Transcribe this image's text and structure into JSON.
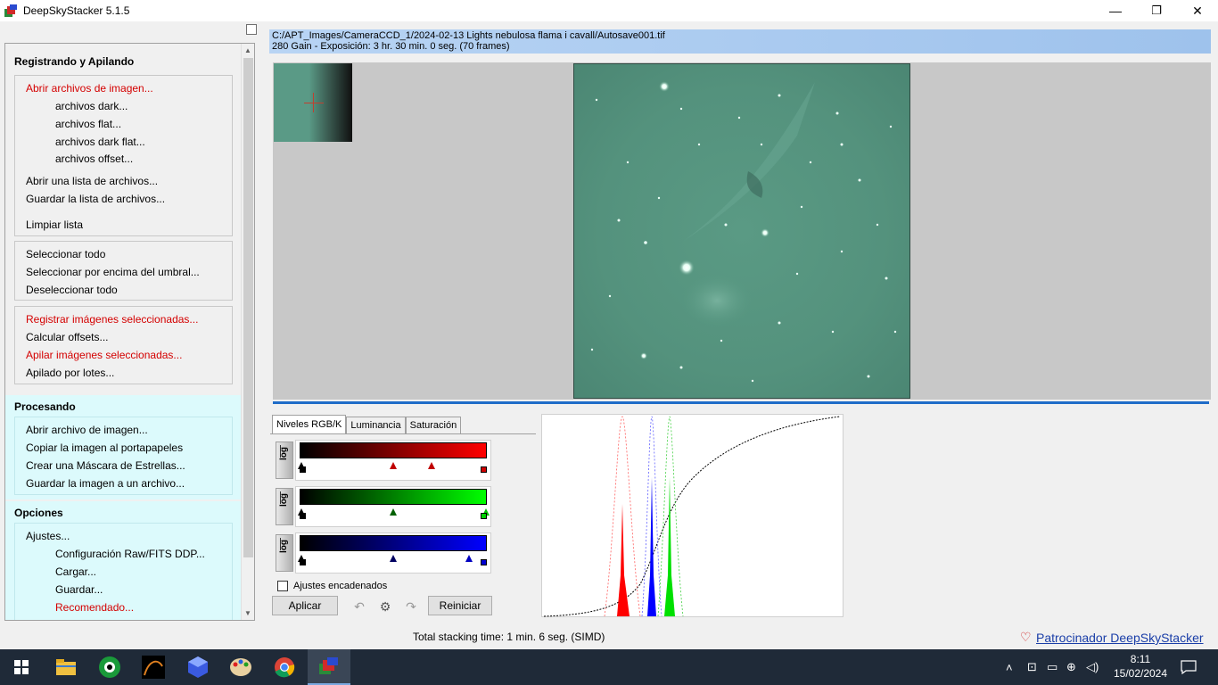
{
  "window": {
    "title": "DeepSkyStacker 5.1.5",
    "minimize": "—",
    "maximize": "❐",
    "close": "✕"
  },
  "left_panel": {
    "sections": [
      {
        "title": "Registrando y Apilando",
        "groups": [
          {
            "items": [
              {
                "label": "Abrir archivos de imagen...",
                "style": "red",
                "indent": false
              },
              {
                "label": "archivos dark...",
                "style": "normal",
                "indent": true
              },
              {
                "label": "archivos flat...",
                "style": "normal",
                "indent": true
              },
              {
                "label": "archivos dark flat...",
                "style": "normal",
                "indent": true
              },
              {
                "label": "archivos offset...",
                "style": "normal",
                "indent": true
              },
              {
                "label": "Abrir una lista de archivos...",
                "style": "normal",
                "indent": false
              },
              {
                "label": "Guardar la lista de archivos...",
                "style": "normal",
                "indent": false
              },
              {
                "label": "Limpiar lista",
                "style": "normal",
                "indent": false
              }
            ]
          },
          {
            "items": [
              {
                "label": "Seleccionar todo",
                "style": "normal"
              },
              {
                "label": "Seleccionar por encima del umbral...",
                "style": "normal"
              },
              {
                "label": "Deseleccionar todo",
                "style": "normal"
              }
            ]
          },
          {
            "items": [
              {
                "label": "Registrar imágenes seleccionadas...",
                "style": "red"
              },
              {
                "label": "Calcular offsets...",
                "style": "normal"
              },
              {
                "label": "Apilar imágenes seleccionadas...",
                "style": "red"
              },
              {
                "label": "Apilado por lotes...",
                "style": "normal"
              }
            ]
          }
        ]
      },
      {
        "title": "Procesando",
        "items": [
          {
            "label": "Abrir archivo de imagen..."
          },
          {
            "label": "Copiar la imagen al portapapeles"
          },
          {
            "label": "Crear una Máscara de Estrellas..."
          },
          {
            "label": "Guardar la imagen a un archivo..."
          }
        ]
      },
      {
        "title": "Opciones",
        "items": [
          {
            "label": "Ajustes...",
            "style": "normal",
            "indent": false
          },
          {
            "label": "Configuración Raw/FITS DDP...",
            "style": "normal",
            "indent": true
          },
          {
            "label": "Cargar...",
            "style": "normal",
            "indent": true
          },
          {
            "label": "Guardar...",
            "style": "normal",
            "indent": true
          },
          {
            "label": "Recomendado...",
            "style": "red",
            "indent": true
          }
        ]
      }
    ]
  },
  "file_info": {
    "path": "C:/APT_Images/CameraCCD_1/2024-02-13 Lights nebulosa flama i cavall/Autosave001.tif",
    "details": "280 Gain - Exposición: 3 hr. 30 min. 0 seg. (70 frames)"
  },
  "tabs": [
    {
      "label": "Niveles RGB/K",
      "active": true
    },
    {
      "label": "Luminancia",
      "active": false
    },
    {
      "label": "Saturación",
      "active": false
    }
  ],
  "levels": {
    "log_label": "log",
    "linked_label": "Ajustes encadenados",
    "linked_checked": false,
    "apply_button": "Aplicar",
    "reset_button": "Reiniciar",
    "channels": [
      {
        "name": "red",
        "color": "#ff0000"
      },
      {
        "name": "green",
        "color": "#00ff00"
      },
      {
        "name": "blue",
        "color": "#0000ff"
      }
    ]
  },
  "status": {
    "stacking_time": "Total stacking time: 1 min. 6 seg.  (SIMD)",
    "sponsor_link": "Patrocinador DeepSkyStacker"
  },
  "taskbar": {
    "time": "8:11",
    "date": "15/02/2024",
    "apps": [
      "start-icon",
      "file-explorer-icon",
      "app-eye-icon",
      "app-curve-icon",
      "app-cube-icon",
      "paint-icon",
      "chrome-icon",
      "deepskystacker-icon"
    ]
  }
}
